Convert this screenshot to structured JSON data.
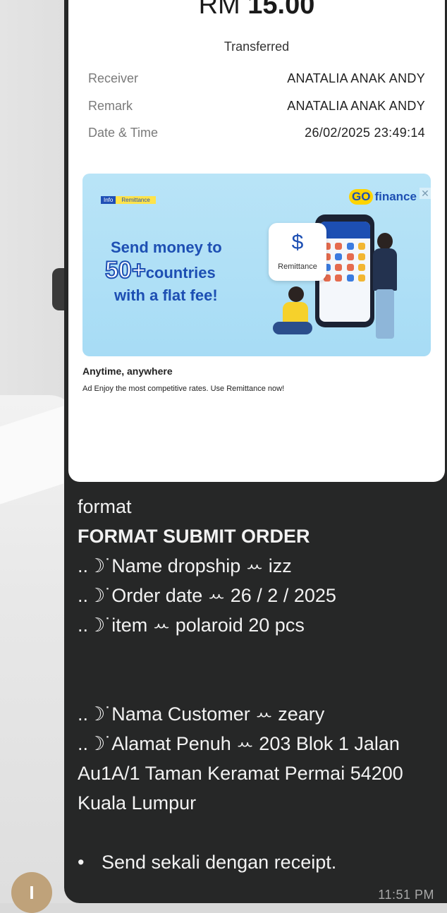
{
  "receipt": {
    "currency": "RM",
    "amount": "15.00",
    "status": "Transferred",
    "fields": [
      {
        "label": "Receiver",
        "value": "ANATALIA ANAK ANDY"
      },
      {
        "label": "Remark",
        "value": "ANATALIA ANAK ANDY"
      },
      {
        "label": "Date & Time",
        "value": "26/02/2025 23:49:14"
      }
    ]
  },
  "ad": {
    "tag_left": "Info",
    "tag_right": "Remittance",
    "brand_go": "GO",
    "brand_rest": "finance",
    "close_glyph": "✕",
    "headline_1": "Send money to",
    "headline_num": "50+",
    "headline_2": "countries",
    "headline_3": "with a flat fee!",
    "card_label": "Remittance",
    "card_icon": "$",
    "title": "Anytime, anywhere",
    "subtitle": "Ad Enjoy the most competitive rates. Use Remittance now!"
  },
  "message": {
    "lines": [
      "format",
      "FORMAT SUBMIT ORDER",
      "..☽˙Name dropship ꕀ izz",
      "..☽˙Order date ꕀ 26 / 2 / 2025",
      "..☽˙item ꕀ polaroid 20 pcs",
      "..☽˙Nama Customer ꕀ zeary",
      "..☽˙Alamat Penuh ꕀ 203 Blok 1 Jalan Au1A/1 Taman Keramat Permai 54200 Kuala Lumpur",
      "Send sekali dengan receipt."
    ],
    "bullet": "•",
    "time": "11:51 PM"
  },
  "avatar": {
    "initial": "I"
  }
}
